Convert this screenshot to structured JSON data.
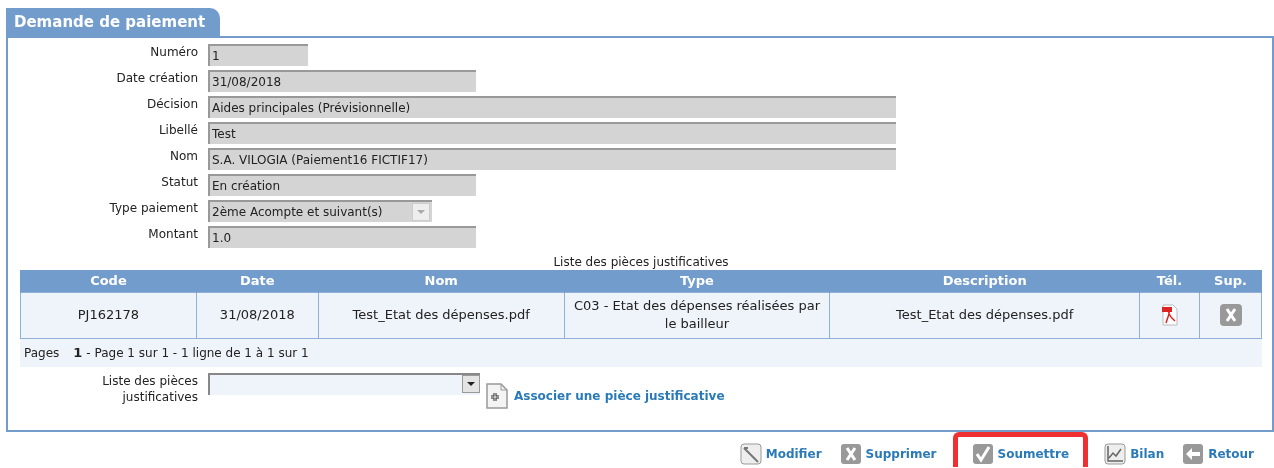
{
  "panel": {
    "title": "Demande de paiement"
  },
  "fields": [
    {
      "label": "Numéro",
      "value": "1",
      "kind": "short"
    },
    {
      "label": "Date création",
      "value": "31/08/2018",
      "kind": "medium"
    },
    {
      "label": "Décision",
      "value": "Aides principales (Prévisionnelle)",
      "kind": "long"
    },
    {
      "label": "Libellé",
      "value": "Test",
      "kind": "long"
    },
    {
      "label": "Nom",
      "value": "S.A. VILOGIA (Paiement16 FICTIF17)",
      "kind": "long"
    },
    {
      "label": "Statut",
      "value": "En création",
      "kind": "medium"
    },
    {
      "label": "Type paiement",
      "value": "2ème Acompte et suivant(s)",
      "kind": "select"
    },
    {
      "label": "Montant",
      "value": "1.0",
      "kind": "medium"
    }
  ],
  "table": {
    "caption": "Liste des pièces justificatives",
    "columns": [
      "Code",
      "Date",
      "Nom",
      "Type",
      "Description",
      "Tél.",
      "Sup."
    ],
    "rows": [
      {
        "code": "PJ162178",
        "date": "31/08/2018",
        "nom": "Test_Etat des dépenses.pdf",
        "type": "C03 - Etat des dépenses réalisées par le bailleur",
        "description": "Test_Etat des dépenses.pdf"
      }
    ]
  },
  "pager": {
    "label": "Pages",
    "current": "1",
    "summary": "- Page 1 sur 1 - 1 ligne de 1 à 1 sur 1"
  },
  "attach": {
    "label": "Liste des pièces justificatives",
    "link": "Associer une pièce justificative"
  },
  "actions": [
    {
      "kind": "edit",
      "label": "Modifier",
      "highlighted": false
    },
    {
      "kind": "delete",
      "label": "Supprimer",
      "highlighted": false
    },
    {
      "kind": "submit",
      "label": "Soumettre",
      "highlighted": true
    },
    {
      "kind": "chart",
      "label": "Bilan",
      "highlighted": false
    },
    {
      "kind": "back",
      "label": "Retour",
      "highlighted": false
    }
  ]
}
